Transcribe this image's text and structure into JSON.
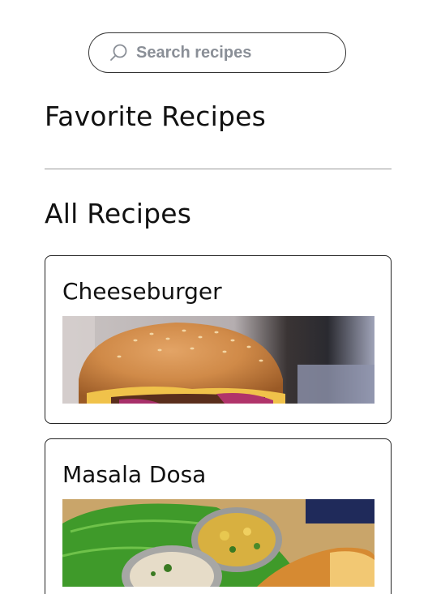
{
  "search": {
    "placeholder": "Search recipes",
    "value": ""
  },
  "sections": {
    "favorites_title": "Favorite Recipes",
    "all_title": "All Recipes"
  },
  "recipes": [
    {
      "title": "Cheeseburger",
      "image": "cheeseburger-photo"
    },
    {
      "title": "Masala Dosa",
      "image": "masala-dosa-photo"
    }
  ],
  "colors": {
    "text": "#111111",
    "placeholder": "#8a8f97",
    "border": "#222222",
    "divider": "#9a9a9a"
  }
}
